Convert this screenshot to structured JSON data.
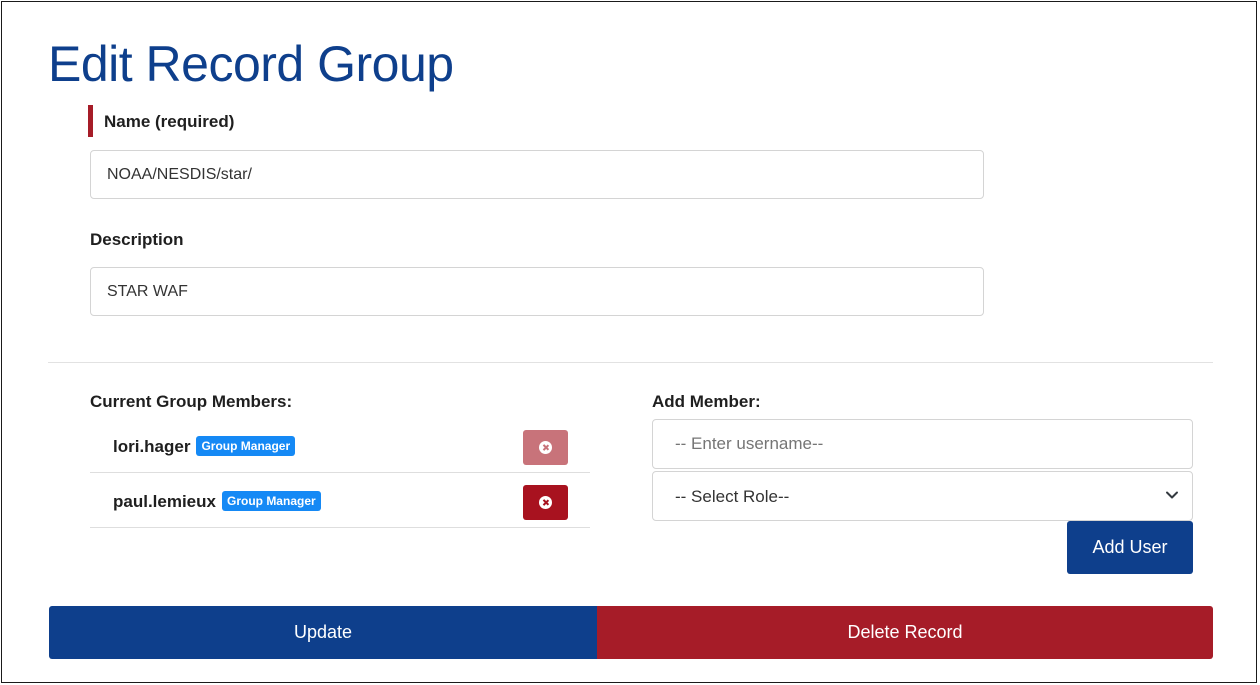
{
  "page": {
    "title": "Edit Record Group"
  },
  "form": {
    "name_label": "Name (required)",
    "name_value": "NOAA/NESDIS/star/",
    "description_label": "Description",
    "description_value": "STAR WAF"
  },
  "members": {
    "heading": "Current Group Members:",
    "items": [
      {
        "username": "lori.hager",
        "role": "Group Manager",
        "remove_state": "disabled"
      },
      {
        "username": "paul.lemieux",
        "role": "Group Manager",
        "remove_state": "enabled"
      }
    ]
  },
  "add_member": {
    "heading": "Add Member:",
    "username_placeholder": "-- Enter username--",
    "role_selected": "-- Select Role--",
    "add_button": "Add User"
  },
  "actions": {
    "update_label": "Update",
    "delete_label": "Delete Record"
  },
  "colors": {
    "brand_blue": "#0e3f8c",
    "danger_red": "#a61c28",
    "badge_blue": "#1589f5"
  },
  "icons": {
    "remove": "x-circle-icon",
    "select": "chevron-down-icon"
  }
}
